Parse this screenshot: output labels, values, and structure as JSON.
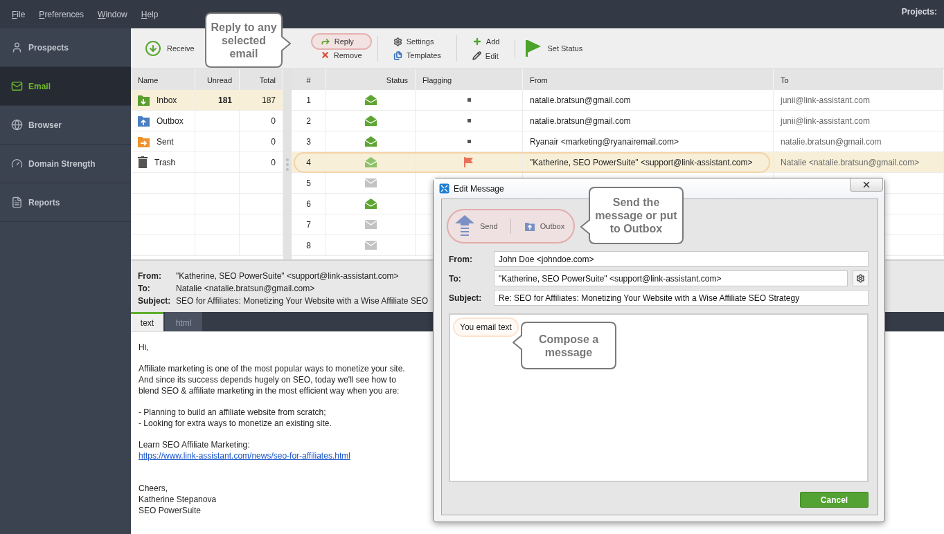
{
  "menu": [
    {
      "label": "File"
    },
    {
      "label": "Preferences"
    },
    {
      "label": "Window"
    },
    {
      "label": "Help"
    }
  ],
  "projects_label": "Projects:",
  "sidebar": {
    "items": [
      {
        "label": "Prospects",
        "kind": "person",
        "selected": false
      },
      {
        "label": "Email",
        "kind": "mail",
        "selected": true
      },
      {
        "label": "Browser",
        "kind": "globe",
        "selected": false
      },
      {
        "label": "Domain Strength",
        "kind": "gauge",
        "selected": false
      },
      {
        "label": "Reports",
        "kind": "report",
        "selected": false
      }
    ]
  },
  "toolbar": {
    "groups": [
      {
        "items": [
          {
            "kind": "receive",
            "label": "Receive",
            "highlighted": false
          }
        ]
      },
      {
        "items": [
          {
            "kind": "reply",
            "label": "Reply",
            "highlighted": true
          },
          {
            "kind": "remove",
            "label": "Remove",
            "highlighted": false
          }
        ]
      },
      {
        "items": [
          {
            "kind": "settings",
            "label": "Settings",
            "highlighted": false
          },
          {
            "kind": "templates",
            "label": "Templates",
            "highlighted": false
          }
        ]
      },
      {
        "items": [
          {
            "kind": "add",
            "label": "Add",
            "highlighted": false
          },
          {
            "kind": "edit",
            "label": "Edit",
            "highlighted": false
          }
        ]
      },
      {
        "items": [
          {
            "kind": "flag",
            "label": "Set Status",
            "highlighted": false
          }
        ]
      }
    ]
  },
  "callouts": [
    {
      "text": "Reply to any selected email"
    },
    {
      "text": "Send the message or put to Outbox"
    },
    {
      "text": "Compose a message"
    }
  ],
  "folders": {
    "columns": [
      "Name",
      "Unread",
      "Total"
    ],
    "rows": [
      {
        "name": "Inbox",
        "kind": "inbox",
        "unread": "181",
        "total": "187",
        "selected": true
      },
      {
        "name": "Outbox",
        "kind": "outbox",
        "total": "0",
        "selected": false
      },
      {
        "name": "Sent",
        "kind": "sent",
        "total": "0",
        "selected": false
      },
      {
        "name": "Trash",
        "kind": "trash",
        "total": "0",
        "selected": false
      }
    ]
  },
  "messages": {
    "columns": [
      "#",
      "Status",
      "Flagging",
      "From",
      "To"
    ],
    "rows": [
      {
        "number": "1",
        "opened": true,
        "flagged": false,
        "from": "natalie.bratsun@gmail.com",
        "to": "junii@link-assistant.com",
        "selected": false
      },
      {
        "number": "2",
        "opened": true,
        "flagged": false,
        "from": "natalie.bratsun@gmail.com",
        "to": "junii@link-assistant.com",
        "selected": false
      },
      {
        "number": "3",
        "opened": true,
        "flagged": false,
        "from": "Ryanair <marketing@ryanairemail.com>",
        "to": "natalie.bratsun@gmail.com",
        "selected": false
      },
      {
        "number": "4",
        "opened": true,
        "flagged": true,
        "from": "\"Katherine, SEO PowerSuite\" <support@link-assistant.com>",
        "to": "Natalie <natalie.bratsun@gmail.com>",
        "selected": true
      },
      {
        "number": "5",
        "opened": false,
        "selected": false
      },
      {
        "number": "6",
        "opened": true,
        "selected": false
      },
      {
        "number": "7",
        "opened": false,
        "selected": false
      },
      {
        "number": "8",
        "opened": false,
        "selected": false
      }
    ]
  },
  "preview": {
    "fields": [
      {
        "label": "From:",
        "value": "\"Katherine, SEO PowerSuite\" <support@link-assistant.com>"
      },
      {
        "label": "To:",
        "value": "Natalie <natalie.bratsun@gmail.com>"
      },
      {
        "label": "Subject:",
        "value": "SEO for Affiliates: Monetizing Your Website with a Wise Affiliate SEO"
      }
    ],
    "tabs": [
      {
        "label": "text",
        "selected": true
      },
      {
        "label": "html",
        "selected": false
      }
    ],
    "body": [
      {
        "lines": [
          {
            "kind": "text",
            "text": "Hi,"
          }
        ]
      },
      {
        "lines": [
          {
            "kind": "text",
            "text": "Affiliate marketing is one of the most popular ways to monetize your site."
          },
          {
            "kind": "text",
            "text": "And since its success depends hugely on SEO, today we'll see how to"
          },
          {
            "kind": "text",
            "text": "blend SEO & affiliate marketing in the most efficient way when you are:"
          }
        ]
      },
      {
        "lines": [
          {
            "kind": "text",
            "text": "- Planning to build an affiliate website from scratch;"
          },
          {
            "kind": "text",
            "text": "- Looking for extra ways to monetize an existing site."
          }
        ]
      },
      {
        "lines": [
          {
            "kind": "text",
            "text": "Learn SEO Affiliate Marketing:"
          },
          {
            "kind": "link",
            "text": "https://www.link-assistant.com/news/seo-for-affiliates.html"
          }
        ]
      },
      {
        "lines": [
          {
            "kind": "text",
            "text": "Cheers,"
          },
          {
            "kind": "text",
            "text": "Katherine Stepanova"
          },
          {
            "kind": "text",
            "text": "SEO PowerSuite"
          }
        ]
      }
    ]
  },
  "dialog": {
    "title": "Edit Message",
    "actions": [
      {
        "kind": "send",
        "label": "Send"
      },
      {
        "kind": "outbox",
        "label": "Outbox"
      }
    ],
    "fields": [
      {
        "label": "From:",
        "value": "John Doe <johndoe.com>",
        "settings": false
      },
      {
        "label": "To:",
        "value": "\"Katherine, SEO PowerSuite\" <support@link-assistant.com>",
        "settings": true
      },
      {
        "label": "Subject:",
        "value": "Re: SEO for Affiliates: Monetizing Your Website with a Wise Affiliate SEO Strategy",
        "settings": false
      }
    ],
    "body": "You email text",
    "cancel": "Cancel"
  }
}
